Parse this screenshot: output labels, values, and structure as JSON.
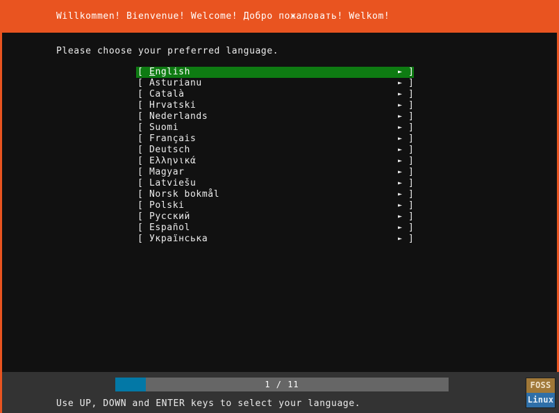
{
  "header": {
    "title": "Willkommen! Bienvenue! Welcome! Добро пожаловать! Welkom!",
    "background_color": "#E95420",
    "text_color": "#FFFFFF"
  },
  "main": {
    "prompt": "Please choose your preferred language.",
    "background_color": "#111111",
    "border_color": "#E95420",
    "selection_color": "#0E7B12",
    "arrow_glyph": "►",
    "bracket_open": "[",
    "bracket_close": "]",
    "languages": [
      {
        "label": "English",
        "mnemonic": "E",
        "rest": "nglish",
        "selected": true
      },
      {
        "label": "Asturianu",
        "selected": false
      },
      {
        "label": "Català",
        "selected": false
      },
      {
        "label": "Hrvatski",
        "selected": false
      },
      {
        "label": "Nederlands",
        "selected": false
      },
      {
        "label": "Suomi",
        "selected": false
      },
      {
        "label": "Français",
        "selected": false
      },
      {
        "label": "Deutsch",
        "selected": false
      },
      {
        "label": "Ελληνικά",
        "selected": false
      },
      {
        "label": "Magyar",
        "selected": false
      },
      {
        "label": "Latviešu",
        "selected": false
      },
      {
        "label": "Norsk bokmål",
        "selected": false
      },
      {
        "label": "Polski",
        "selected": false
      },
      {
        "label": "Русский",
        "selected": false
      },
      {
        "label": "Español",
        "selected": false
      },
      {
        "label": "Українська",
        "selected": false
      }
    ]
  },
  "footer": {
    "progress_label": "1 / 11",
    "progress_current": 1,
    "progress_total": 11,
    "progress_fill_color": "#0378A6",
    "progress_track_color": "#666666",
    "hint": "Use UP, DOWN and ENTER keys to select your language.",
    "background_color": "#333333"
  },
  "watermark": {
    "line1": "FOSS",
    "line2": "Linux",
    "line1_color": "#A07838",
    "line2_color": "#2F6FA8"
  }
}
